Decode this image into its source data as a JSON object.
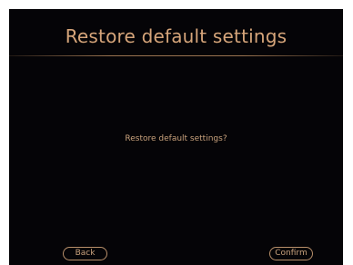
{
  "header": {
    "title": "Restore default settings"
  },
  "dialog": {
    "message": "Restore default settings?"
  },
  "footer": {
    "back_label": "Back",
    "confirm_label": "Confirm"
  },
  "colors": {
    "background": "#050407",
    "accent": "#d6a57a",
    "divider": "#9a7350"
  }
}
